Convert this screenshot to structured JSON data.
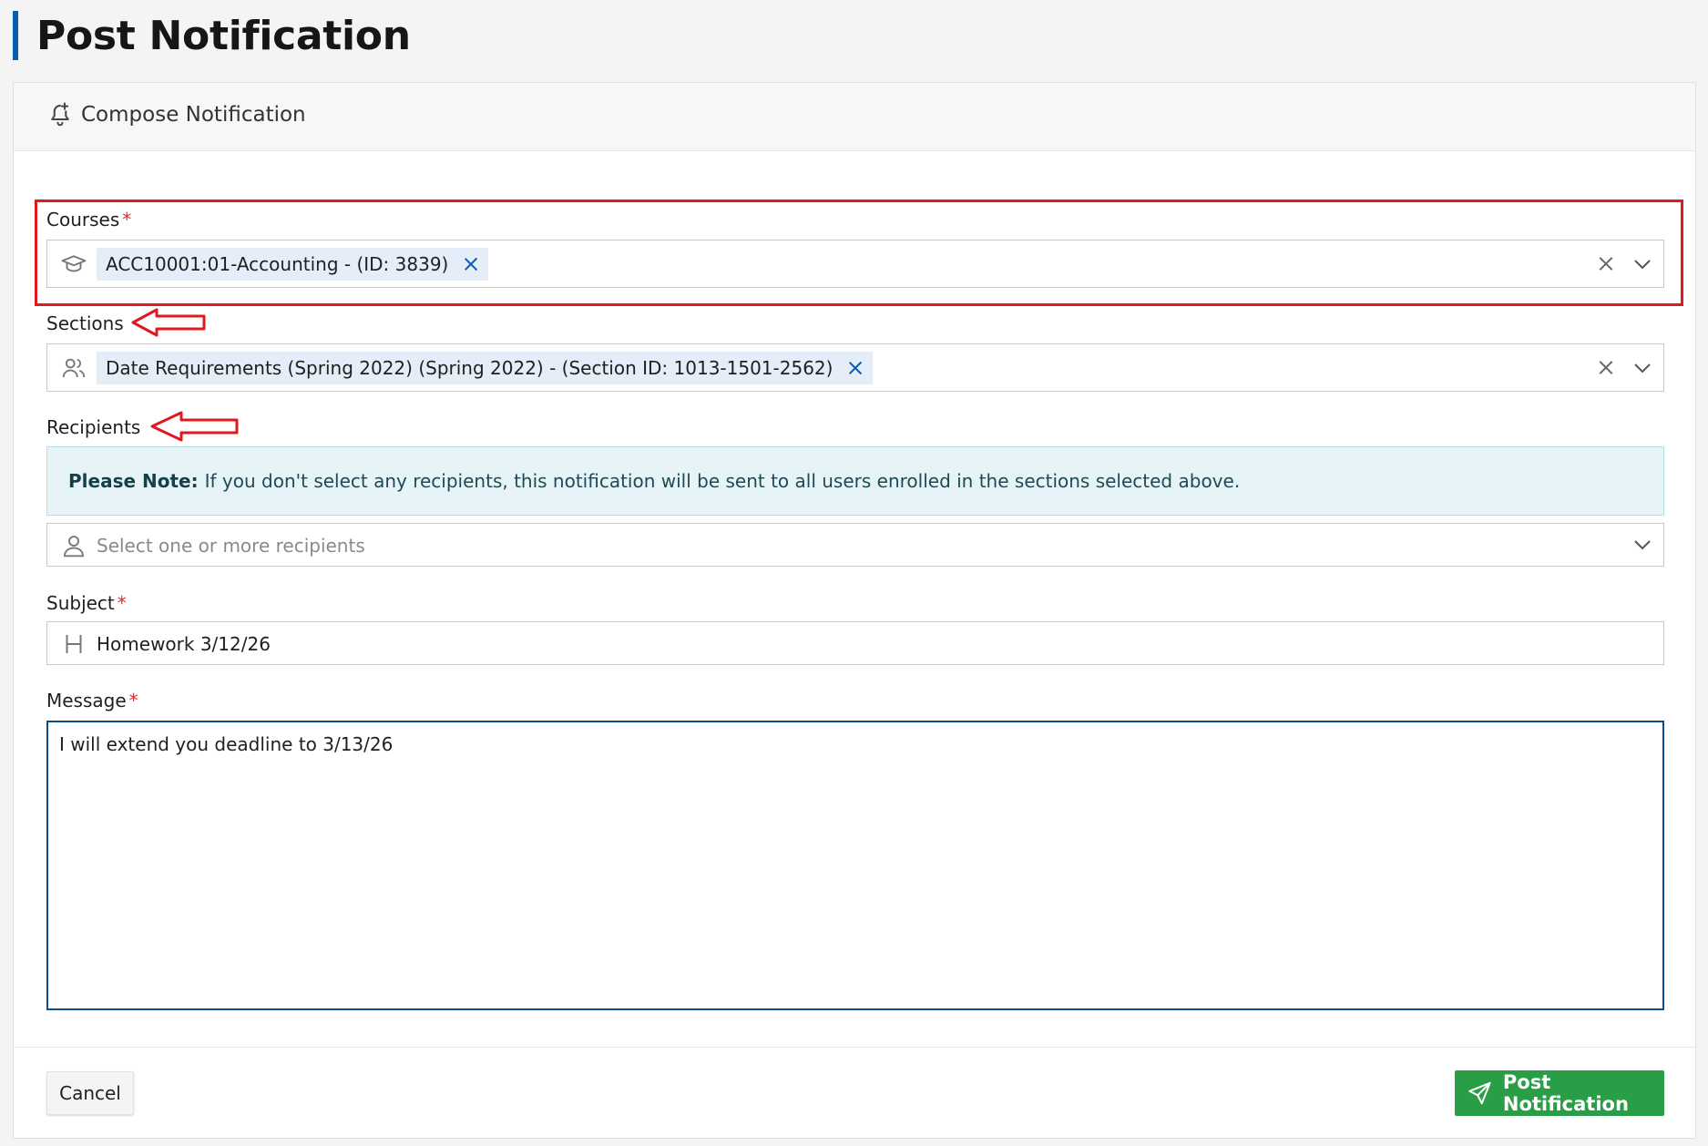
{
  "page": {
    "title": "Post Notification"
  },
  "card": {
    "header_title": "Compose Notification"
  },
  "courses": {
    "label": "Courses",
    "required_mark": "*",
    "selected_chip": "ACC10001:01-Accounting - (ID: 3839)"
  },
  "sections": {
    "label": "Sections",
    "selected_chip": "Date Requirements (Spring 2022) (Spring 2022) - (Section ID: 1013-1501-2562)"
  },
  "recipients": {
    "label": "Recipients",
    "note_bold": "Please Note:",
    "note_text": "If you don't select any recipients, this notification will be sent to all users enrolled in the sections selected above.",
    "placeholder": "Select one or more recipients"
  },
  "subject": {
    "label": "Subject",
    "required_mark": "*",
    "value": "Homework 3/12/26"
  },
  "message": {
    "label": "Message",
    "required_mark": "*",
    "value": "I will extend you deadline to 3/13/26"
  },
  "actions": {
    "cancel_label": "Cancel",
    "post_label": "Post Notification"
  },
  "colors": {
    "accent": "#0b5bb5",
    "post_button": "#2a9d47",
    "annotation": "#e0191f",
    "required": "#d32f2f"
  },
  "icons": {
    "header": "bell-plus-icon",
    "courses": "graduation-cap-icon",
    "sections": "users-icon",
    "recipients": "user-icon",
    "subject": "heading-icon",
    "post": "send-icon"
  }
}
